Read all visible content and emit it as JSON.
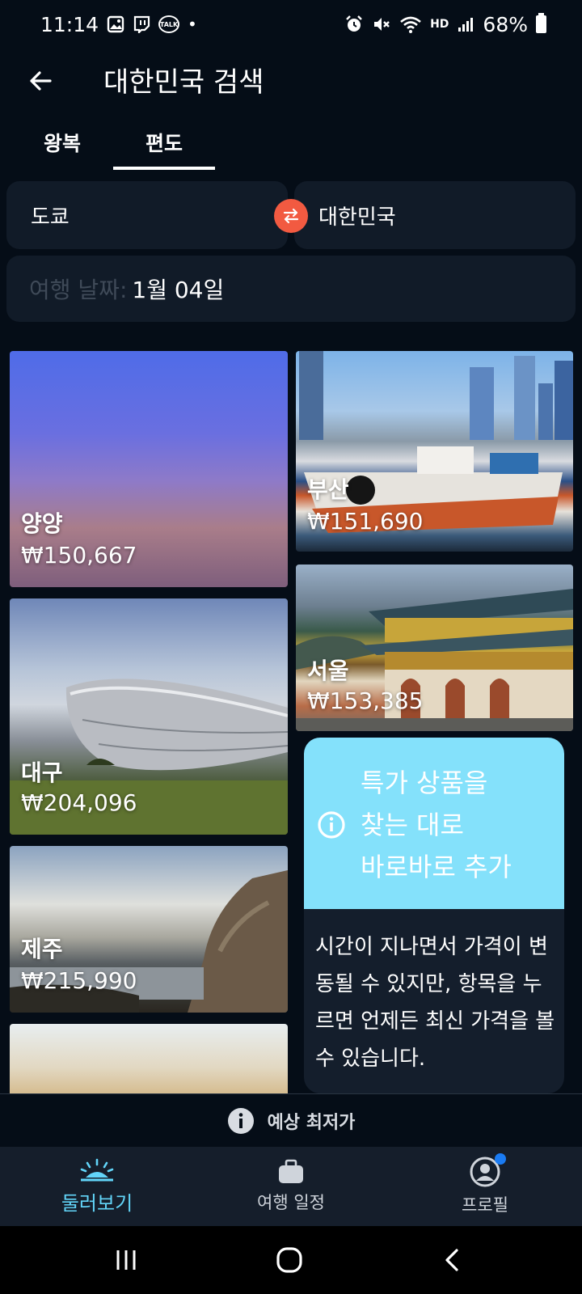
{
  "status_bar": {
    "time": "11:14",
    "battery": "68%",
    "left_icons": [
      "image-icon",
      "twitch-icon",
      "kakaotalk-icon",
      "dot-icon"
    ],
    "right_icons": [
      "alarm-icon",
      "mute-icon",
      "wifi-icon",
      "hd-voice-icon",
      "signal-icon",
      "battery-icon"
    ],
    "talk_badge": "TALK",
    "hd_badge": "HD"
  },
  "header": {
    "title": "대한민국 검색"
  },
  "tabs": [
    {
      "label": "왕복",
      "active": false
    },
    {
      "label": "편도",
      "active": true
    }
  ],
  "route": {
    "origin": "도쿄",
    "destination": "대한민국"
  },
  "date": {
    "label": "여행 날짜:",
    "value": "1월 04일"
  },
  "destinations": [
    {
      "name": "양양",
      "price": "₩150,667"
    },
    {
      "name": "부산",
      "price": "₩151,690"
    },
    {
      "name": "서울",
      "price": "₩153,385"
    },
    {
      "name": "대구",
      "price": "₩204,096"
    },
    {
      "name": "제주",
      "price": "₩215,990"
    }
  ],
  "deal_card": {
    "headline_line1": "특가 상품을",
    "headline_line2": "찾는 대로",
    "headline_line3": "바로바로 추가",
    "body": "시간이 지나면서 가격이 변동될 수 있지만, 항목을 누르면 언제든 최신 가격을 볼 수 있습니다."
  },
  "price_note": {
    "label": "예상 최저가"
  },
  "bottom_nav": [
    {
      "label": "둘러보기",
      "icon": "sunrise-icon",
      "active": true
    },
    {
      "label": "여행 일정",
      "icon": "briefcase-icon",
      "active": false
    },
    {
      "label": "프로필",
      "icon": "profile-icon",
      "active": false
    }
  ],
  "colors": {
    "background": "#050d17",
    "surface": "#111b28",
    "accent": "#62d5f9",
    "swap": "#f25a41",
    "deal_banner": "#84e1fb",
    "notification_dot": "#1a7bf2"
  }
}
